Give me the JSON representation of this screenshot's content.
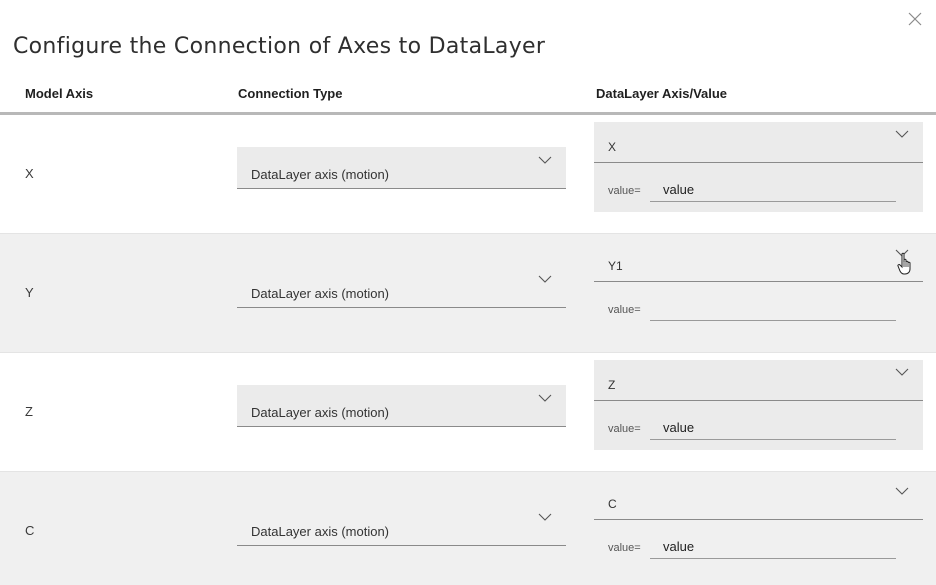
{
  "dialog": {
    "title": "Configure the Connection of Axes to DataLayer",
    "close_icon": "close-icon"
  },
  "table": {
    "headers": {
      "model_axis": "Model Axis",
      "connection_type": "Connection Type",
      "datalayer": "DataLayer Axis/Value"
    },
    "rows": [
      {
        "axis": "X",
        "connection_type": "DataLayer axis (motion)",
        "datalayer_axis": "X",
        "value_label": "value=",
        "value": "value"
      },
      {
        "axis": "Y",
        "connection_type": "DataLayer axis (motion)",
        "datalayer_axis": "Y1",
        "value_label": "value=",
        "value": ""
      },
      {
        "axis": "Z",
        "connection_type": "DataLayer axis (motion)",
        "datalayer_axis": "Z",
        "value_label": "value=",
        "value": "value"
      },
      {
        "axis": "C",
        "connection_type": "DataLayer axis (motion)",
        "datalayer_axis": "C",
        "value_label": "value=",
        "value": "value"
      }
    ]
  },
  "icons": {
    "dropdown": "chevron-down-icon",
    "pointer": "hand-cursor-icon"
  },
  "colors": {
    "alt_row_bg": "#f0f0f0",
    "field_bg": "#ebebeb",
    "header_rule": "#b8b8b8"
  }
}
